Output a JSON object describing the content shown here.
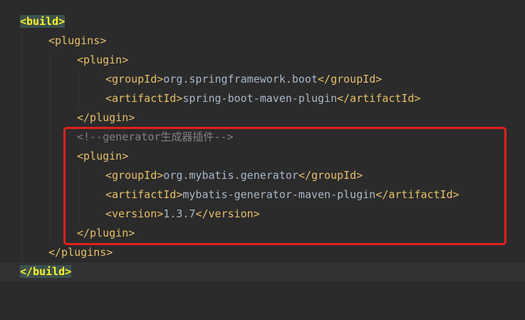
{
  "editor": {
    "lines": [
      {
        "open": "<",
        "name": "build",
        "close": ">"
      },
      {
        "open": "<",
        "name": "plugins",
        "close": ">"
      },
      {
        "open": "<",
        "name": "plugin",
        "close": ">"
      },
      {
        "tag_open": "<groupId>",
        "value": "org.springframework.boot",
        "tag_close": "</groupId>"
      },
      {
        "tag_open": "<artifactId>",
        "value": "spring-boot-maven-plugin",
        "tag_close": "</artifactId>"
      },
      {
        "text": "</plugin>"
      },
      {
        "text": "<!--generator生成器插件-->"
      },
      {
        "text": "<plugin>"
      },
      {
        "tag_open": "<groupId>",
        "value": "org.mybatis.generator",
        "tag_close": "</groupId>"
      },
      {
        "tag_open": "<artifactId>",
        "value": "mybatis-generator-maven-plugin",
        "tag_close": "</artifactId>"
      },
      {
        "tag_open": "<version>",
        "value": "1.3.7",
        "tag_close": "</version>"
      },
      {
        "text": "</plugin>"
      },
      {
        "text": "</plugins>"
      },
      {
        "open": "</",
        "name": "build",
        "close": ">"
      }
    ]
  },
  "highlight_color": "#e3201b"
}
